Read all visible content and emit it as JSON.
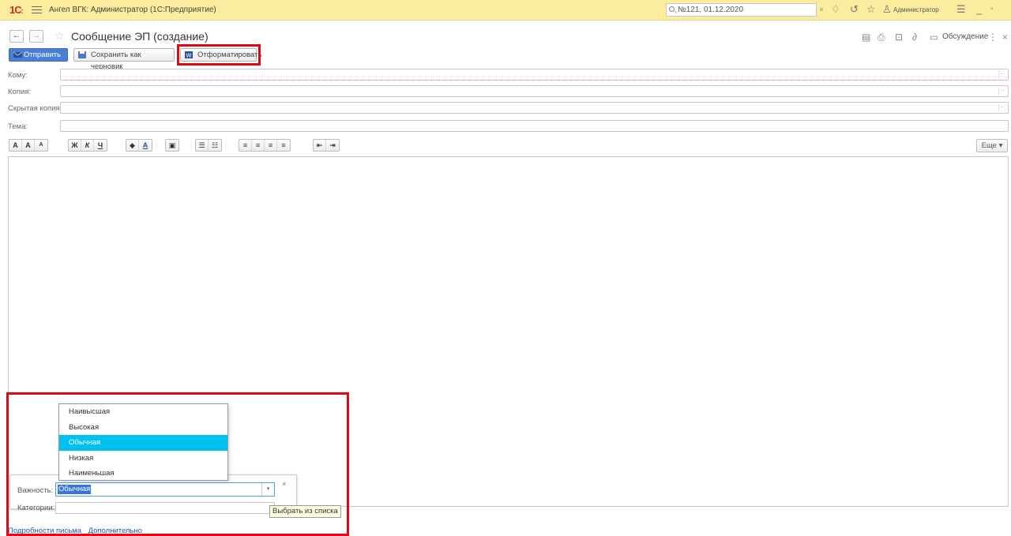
{
  "titlebar": {
    "logo": "1С",
    "app_title": "Ангел ВГК: Администратор  (1С:Предприятие)",
    "search_value": "№121, 01.12.2020",
    "search_clear": "×",
    "user": "Администратор"
  },
  "header": {
    "back": "←",
    "forward": "→",
    "title": "Сообщение ЭП (создание)",
    "discuss": "Обсуждение",
    "more": "⋮",
    "close": "×"
  },
  "toolbar": {
    "send": "Отправить",
    "save_draft": "Сохранить как черновик",
    "format": "Отформатировать"
  },
  "fields": {
    "to_label": "Кому:",
    "cc_label": "Копия:",
    "bcc_label": "Скрытая копия:",
    "subject_label": "Тема:",
    "more_glyph": "..."
  },
  "format_toolbar": {
    "font_group": [
      "A",
      "A",
      "A"
    ],
    "style_group": [
      "Ж",
      "К",
      "Ч"
    ],
    "color_group": [
      "◆",
      "A"
    ],
    "picture_group": [
      "▣"
    ],
    "list_group": [
      "☰",
      "☷"
    ],
    "align_group": [
      "≡",
      "≡",
      "≡",
      "≡"
    ],
    "indent_group": [
      "⇤",
      "⇥"
    ],
    "more": "Еще ▾"
  },
  "panel": {
    "importance_label": "Важность:",
    "importance_value": "Обычная",
    "category_label": "Категории:",
    "close": "×",
    "tooltip": "Выбрать из списка"
  },
  "importance_options": [
    "Наивысшая",
    "Высокая",
    "Обычная",
    "Низкая",
    "Наименьшая"
  ],
  "selected_option": "Обычная",
  "links": {
    "details": "Подробности письма",
    "additional": "Дополнительно"
  },
  "colors": {
    "titlebar": "#fbed9e",
    "primary": "#4a7fd6",
    "highlight_frame": "#e30613",
    "selected_item": "#00c0f0"
  }
}
